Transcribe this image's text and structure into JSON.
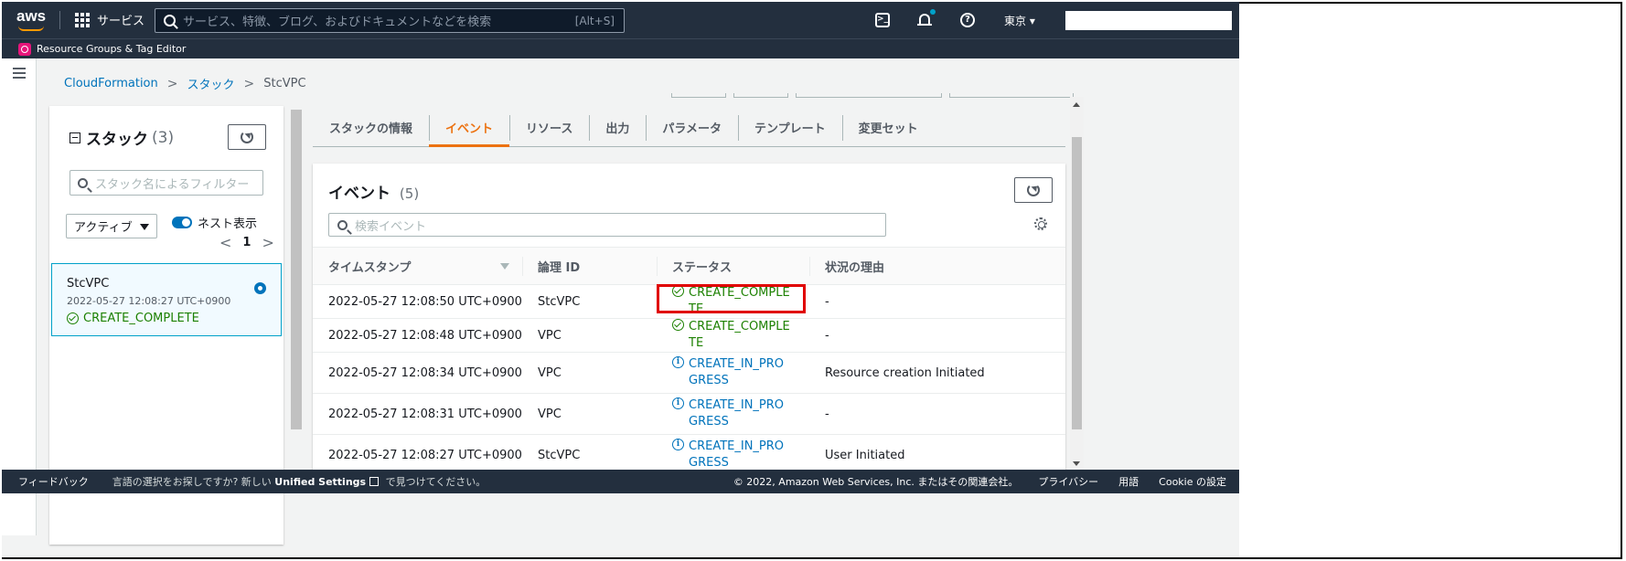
{
  "topnav": {
    "logo": "aws",
    "services_label": "サービス",
    "search_placeholder": "サービス、特徴、ブログ、およびドキュメントなどを検索",
    "search_shortcut": "[Alt+S]",
    "region": "東京 ▾"
  },
  "bookmark": {
    "label": "Resource Groups & Tag Editor"
  },
  "breadcrumb": {
    "items": [
      "CloudFormation",
      "スタック",
      "StcVPC"
    ]
  },
  "stacks_panel": {
    "title": "スタック",
    "count": "(3)",
    "filter_placeholder": "スタック名によるフィルター",
    "status_select": "アクティブ",
    "nested_toggle_label": "ネスト表示",
    "page": "1",
    "selected_stack": {
      "name": "StcVPC",
      "timestamp": "2022-05-27 12:08:27 UTC+0900",
      "status": "CREATE_COMPLETE"
    }
  },
  "tabs": [
    {
      "label": "スタックの情報",
      "active": false
    },
    {
      "label": "イベント",
      "active": true
    },
    {
      "label": "リソース",
      "active": false
    },
    {
      "label": "出力",
      "active": false
    },
    {
      "label": "パラメータ",
      "active": false
    },
    {
      "label": "テンプレート",
      "active": false
    },
    {
      "label": "変更セット",
      "active": false
    }
  ],
  "events": {
    "title": "イベント",
    "count": "(5)",
    "search_placeholder": "検索イベント",
    "columns": [
      "タイムスタンプ",
      "論理 ID",
      "ステータス",
      "状況の理由"
    ],
    "rows": [
      {
        "timestamp": "2022-05-27 12:08:50 UTC+0900",
        "logical_id": "StcVPC",
        "status": "CREATE_COMPLETE",
        "status_type": "ok",
        "reason": "-"
      },
      {
        "timestamp": "2022-05-27 12:08:48 UTC+0900",
        "logical_id": "VPC",
        "status": "CREATE_COMPLETE",
        "status_type": "ok",
        "reason": "-"
      },
      {
        "timestamp": "2022-05-27 12:08:34 UTC+0900",
        "logical_id": "VPC",
        "status": "CREATE_IN_PROGRESS",
        "status_type": "prog",
        "reason": "Resource creation Initiated"
      },
      {
        "timestamp": "2022-05-27 12:08:31 UTC+0900",
        "logical_id": "VPC",
        "status": "CREATE_IN_PROGRESS",
        "status_type": "prog",
        "reason": "-"
      },
      {
        "timestamp": "2022-05-27 12:08:27 UTC+0900",
        "logical_id": "StcVPC",
        "status": "CREATE_IN_PROGRESS",
        "status_type": "prog",
        "reason": "User Initiated"
      }
    ]
  },
  "footer": {
    "feedback": "フィードバック",
    "msg_prefix": "言語の選択をお探しですか? 新しい",
    "msg_link": "Unified Settings",
    "msg_suffix": "で見つけてください。",
    "copyright": "© 2022, Amazon Web Services, Inc. またはその関連会社。",
    "privacy": "プライバシー",
    "terms": "用語",
    "cookie": "Cookie の設定"
  },
  "colors": {
    "nav_bg": "#232f3e",
    "accent_orange": "#ec7211",
    "link_blue": "#0073bb",
    "success_green": "#1d8102",
    "highlight_red": "#e00000"
  }
}
